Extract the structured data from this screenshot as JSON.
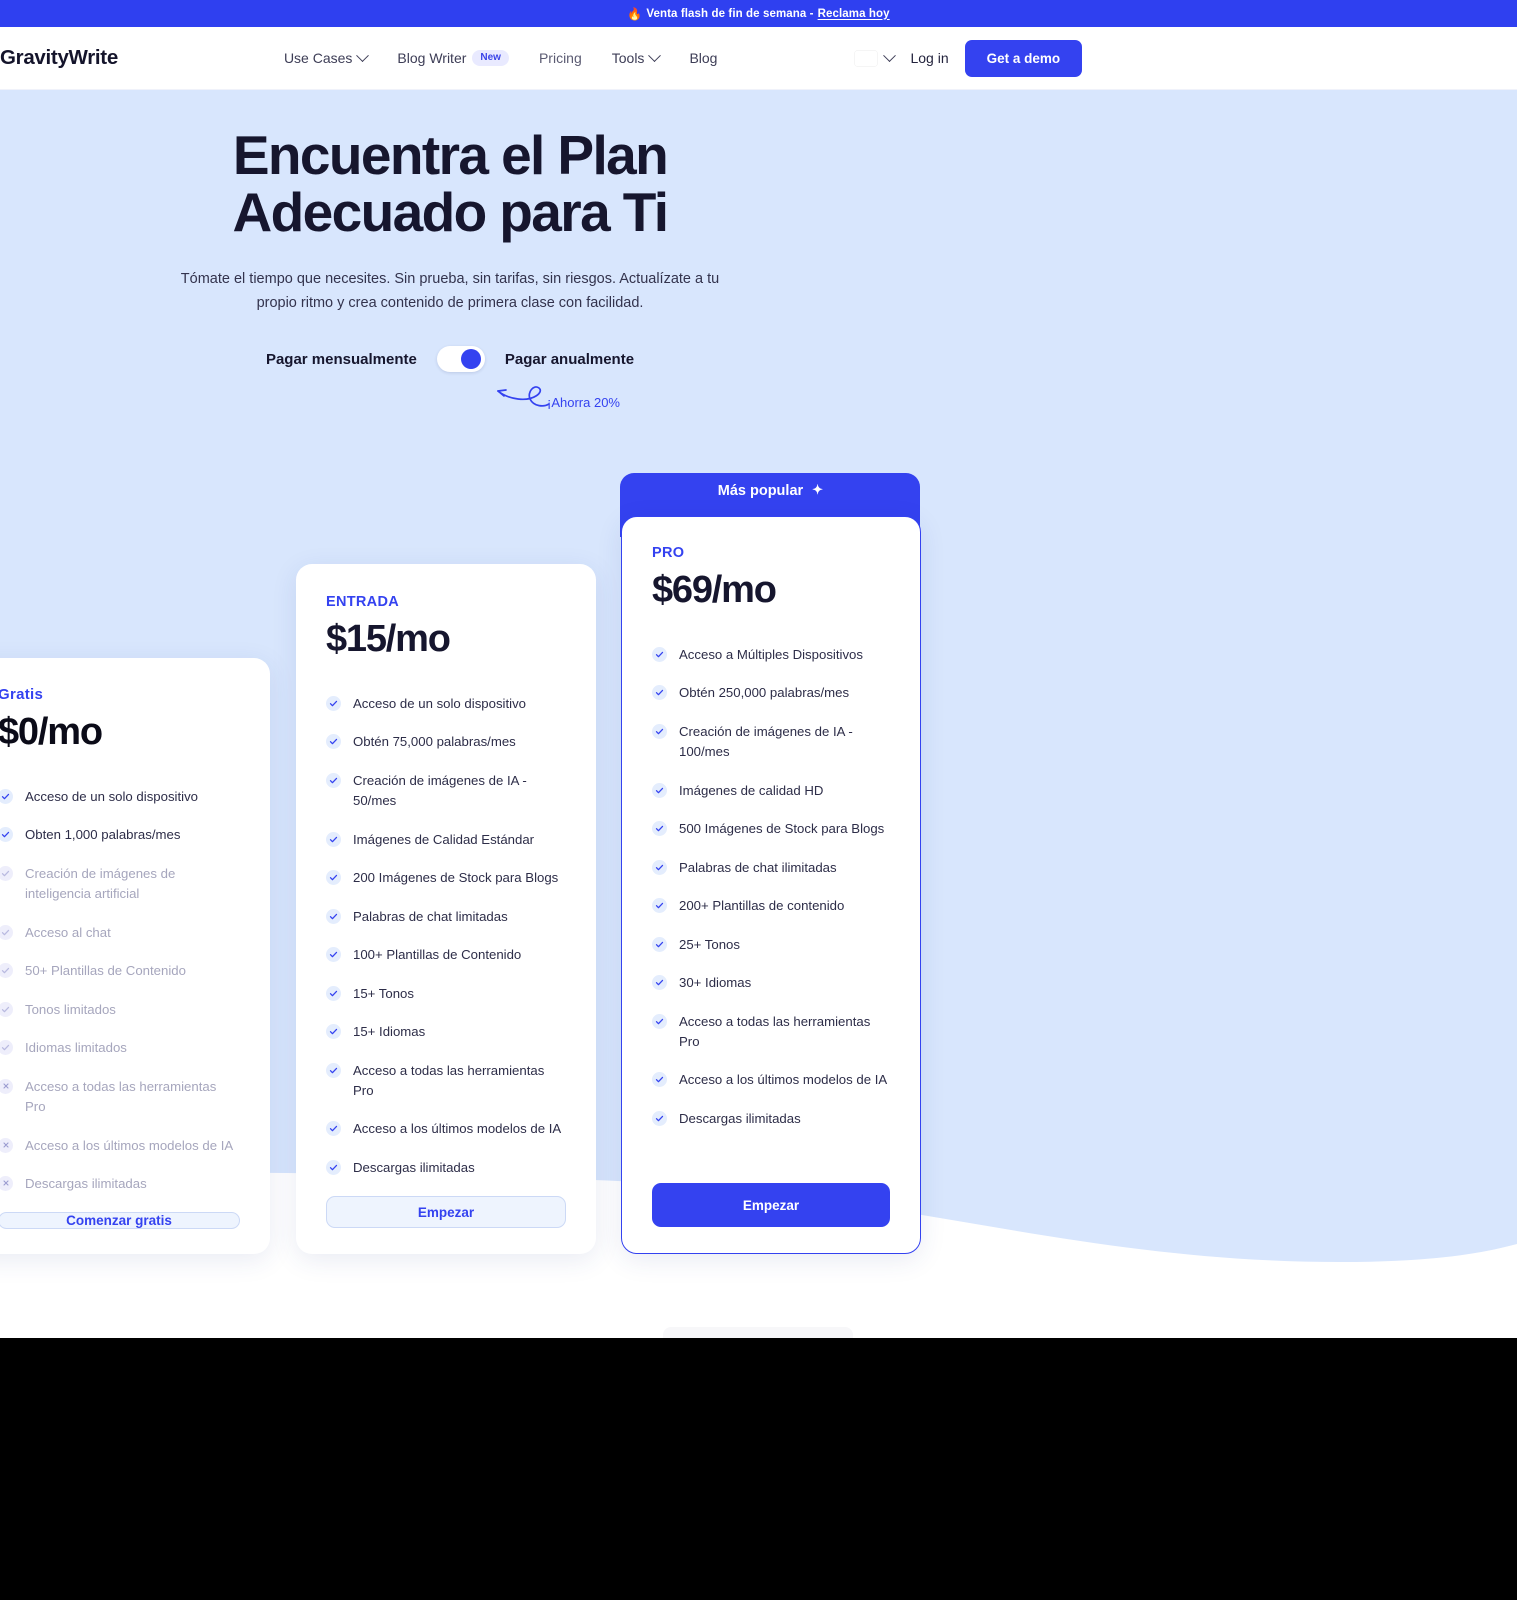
{
  "promo": {
    "icon": "fire-icon",
    "text": "Venta flash de fin de semana -",
    "link_label": "Reclama hoy"
  },
  "nav": {
    "logo": "GravityWrite",
    "items": [
      {
        "label": "Use Cases",
        "has_chevron": true,
        "badge": ""
      },
      {
        "label": "Blog Writer",
        "has_chevron": false,
        "badge": "New"
      },
      {
        "label": "Pricing",
        "has_chevron": false,
        "badge": ""
      },
      {
        "label": "Tools",
        "has_chevron": true,
        "badge": ""
      },
      {
        "label": "Blog",
        "has_chevron": false,
        "badge": ""
      }
    ],
    "language_icon": "spain-flag-icon",
    "login_label": "Log in",
    "demo_label": "Get a demo"
  },
  "hero": {
    "title": "Encuentra el Plan Adecuado para Ti",
    "subtitle": "Tómate el tiempo que necesites. Sin prueba, sin tarifas, sin riesgos. Actualízate a tu propio ritmo y crea contenido de primera clase con facilidad.",
    "toggle": {
      "monthly_label": "Pagar mensualmente",
      "annual_label": "Pagar anualmente",
      "state": "annual",
      "save_note": "¡Ahorra 20%"
    }
  },
  "colors": {
    "accent": "#3442f0",
    "hero_bg": "#d8e6fd",
    "promo_bg": "#2f40f0",
    "text_dark": "#16162e",
    "text_muted": "#a6a6bd"
  },
  "plans": [
    {
      "id": "free",
      "name": "Gratis",
      "price": "$0/mo",
      "badge": "",
      "cta": "Comenzar gratis",
      "cta_style": "outline",
      "features": [
        {
          "text": "Acceso de un solo dispositivo",
          "included": true,
          "dim": false
        },
        {
          "text": "Obten 1,000 palabras/mes",
          "included": true,
          "dim": false
        },
        {
          "text": "Creación de imágenes de inteligencia artificial",
          "included": true,
          "dim": true
        },
        {
          "text": "Acceso al chat",
          "included": true,
          "dim": true
        },
        {
          "text": "50+ Plantillas de Contenido",
          "included": true,
          "dim": true
        },
        {
          "text": "Tonos limitados",
          "included": true,
          "dim": true
        },
        {
          "text": "Idiomas limitados",
          "included": true,
          "dim": true
        },
        {
          "text": "Acceso a todas las herramientas Pro",
          "included": false,
          "dim": true
        },
        {
          "text": "Acceso a los últimos modelos de IA",
          "included": false,
          "dim": true
        },
        {
          "text": "Descargas ilimitadas",
          "included": false,
          "dim": true
        }
      ]
    },
    {
      "id": "entry",
      "name": "ENTRADA",
      "price": "$15/mo",
      "badge": "",
      "cta": "Empezar",
      "cta_style": "outline",
      "features": [
        {
          "text": "Acceso de un solo dispositivo",
          "included": true,
          "dim": false
        },
        {
          "text": "Obtén 75,000 palabras/mes",
          "included": true,
          "dim": false
        },
        {
          "text": "Creación de imágenes de IA - 50/mes",
          "included": true,
          "dim": false
        },
        {
          "text": "Imágenes de Calidad Estándar",
          "included": true,
          "dim": false
        },
        {
          "text": "200 Imágenes de Stock para Blogs",
          "included": true,
          "dim": false
        },
        {
          "text": "Palabras de chat limitadas",
          "included": true,
          "dim": false
        },
        {
          "text": "100+ Plantillas de Contenido",
          "included": true,
          "dim": false
        },
        {
          "text": "15+ Tonos",
          "included": true,
          "dim": false
        },
        {
          "text": "15+ Idiomas",
          "included": true,
          "dim": false
        },
        {
          "text": "Acceso a todas las herramientas Pro",
          "included": true,
          "dim": false
        },
        {
          "text": "Acceso a los últimos modelos de IA",
          "included": true,
          "dim": false
        },
        {
          "text": "Descargas ilimitadas",
          "included": true,
          "dim": false
        }
      ]
    },
    {
      "id": "pro",
      "name": "PRO",
      "price": "$69/mo",
      "badge": "Más popular",
      "cta": "Empezar",
      "cta_style": "solid",
      "features": [
        {
          "text": "Acceso a Múltiples Dispositivos",
          "included": true,
          "dim": false
        },
        {
          "text": "Obtén 250,000 palabras/mes",
          "included": true,
          "dim": false
        },
        {
          "text": "Creación de imágenes de IA - 100/mes",
          "included": true,
          "dim": false
        },
        {
          "text": "Imágenes de calidad HD",
          "included": true,
          "dim": false
        },
        {
          "text": "500 Imágenes de Stock para Blogs",
          "included": true,
          "dim": false
        },
        {
          "text": "Palabras de chat ilimitadas",
          "included": true,
          "dim": false
        },
        {
          "text": "200+ Plantillas de contenido",
          "included": true,
          "dim": false
        },
        {
          "text": "25+ Tonos",
          "included": true,
          "dim": false
        },
        {
          "text": "30+ Idiomas",
          "included": true,
          "dim": false
        },
        {
          "text": "Acceso a todas las herramientas Pro",
          "included": true,
          "dim": false
        },
        {
          "text": "Acceso a los últimos modelos de IA",
          "included": true,
          "dim": false
        },
        {
          "text": "Descargas ilimitadas",
          "included": true,
          "dim": false
        }
      ]
    }
  ]
}
